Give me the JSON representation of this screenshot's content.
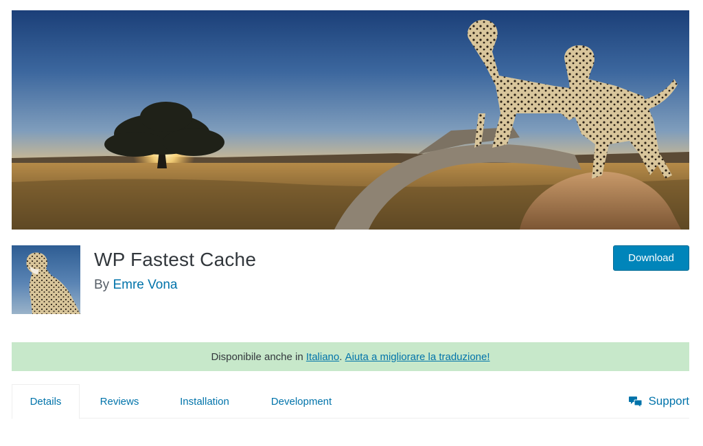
{
  "plugin": {
    "title": "WP Fastest Cache",
    "by_label": "By",
    "author": "Emre Vona",
    "download_label": "Download"
  },
  "notice": {
    "prefix": "Disponibile anche in ",
    "language_link": "Italiano",
    "separator": ". ",
    "help_link": "Aiuta a migliorare la traduzione!"
  },
  "tabs": [
    {
      "label": "Details",
      "active": true
    },
    {
      "label": "Reviews",
      "active": false
    },
    {
      "label": "Installation",
      "active": false
    },
    {
      "label": "Development",
      "active": false
    }
  ],
  "support": {
    "label": "Support",
    "icon": "speech-bubbles-icon"
  },
  "colors": {
    "link": "#0073aa",
    "button": "#0085ba",
    "notice_bg": "#c7e8ca"
  }
}
